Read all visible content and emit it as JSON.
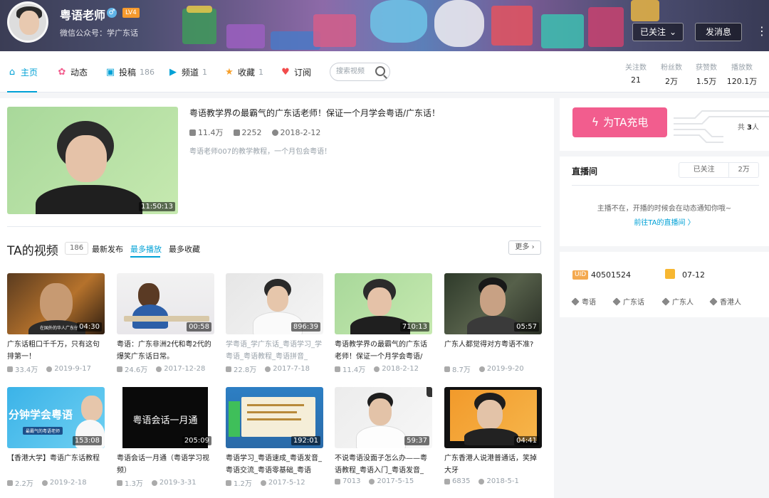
{
  "header": {
    "username": "粤语老师",
    "gender_icon": "male-icon",
    "level": "LV4",
    "subtitle": "微信公众号：学广东话",
    "follow_label": "已关注",
    "message_label": "发消息"
  },
  "nav": {
    "tabs": [
      {
        "label": "主页",
        "count": "",
        "icon": "home-icon"
      },
      {
        "label": "动态",
        "count": "",
        "icon": "feed-icon"
      },
      {
        "label": "投稿",
        "count": "186",
        "icon": "upload-icon"
      },
      {
        "label": "频道",
        "count": "1",
        "icon": "channel-icon"
      },
      {
        "label": "收藏",
        "count": "1",
        "icon": "star-icon"
      },
      {
        "label": "订阅",
        "count": "",
        "icon": "heart-icon"
      }
    ],
    "search_placeholder": "搜索视频",
    "stats": [
      {
        "label": "关注数",
        "value": "21"
      },
      {
        "label": "粉丝数",
        "value": "2万"
      },
      {
        "label": "获赞数",
        "value": "1.5万"
      },
      {
        "label": "播放数",
        "value": "120.1万"
      }
    ]
  },
  "featured": {
    "title": "粤语教学界の最霸气的广东话老师！保证一个月学会粤语/广东话！",
    "views": "11.4万",
    "danmaku": "2252",
    "date": "2018-2-12",
    "description": "粤语老师007的教学教程，一个月包会粤语！",
    "duration": "11:50:13"
  },
  "videos_section": {
    "title": "TA的视频",
    "count": "186",
    "sorts": [
      "最新发布",
      "最多播放",
      "最多收藏"
    ],
    "more": "更多"
  },
  "videos": [
    {
      "title": "广东话粗口千千万，只有这句排第一！",
      "views": "33.4万",
      "date": "2019-9-17",
      "duration": "04:30",
      "thumb_caption": "在国外的华人广东仔"
    },
    {
      "title": "粤语：广东非洲2代和粤2代的爆笑广东话日常。",
      "views": "24.6万",
      "date": "2017-12-28",
      "duration": "00:58",
      "thumb_caption": ""
    },
    {
      "title": "学粤语_学广东话_粤语学习_学粤语_粤语教程_粤语拼音_",
      "views": "22.8万",
      "date": "2017-7-18",
      "duration": "896:39",
      "thumb_caption": ""
    },
    {
      "title": "粤语教学界の最霸气的广东话老师！保证一个月学会粤语/",
      "views": "11.4万",
      "date": "2018-2-12",
      "duration": "710:13",
      "thumb_caption": ""
    },
    {
      "title": "广东人都觉得对方粤语不准?",
      "views": "8.7万",
      "date": "2019-9-20",
      "duration": "05:57",
      "thumb_caption": ""
    },
    {
      "title": "【香港大学】粤语广东话教程",
      "views": "2.2万",
      "date": "2019-2-18",
      "duration": "153:08",
      "thumb_caption": "分钟学会粤语",
      "thumb_sub": "最霸气的粤语老师"
    },
    {
      "title": "粤语会话一月通（粤语学习视频）",
      "views": "1.3万",
      "date": "2019-3-31",
      "duration": "205:09",
      "thumb_caption": "粤语会话一月通"
    },
    {
      "title": "粤语学习_粤语速成_粤语发音_粤语交流_粤语零基础_粤语",
      "views": "1.2万",
      "date": "2017-5-12",
      "duration": "192:01",
      "thumb_caption": ""
    },
    {
      "title": "不说粤语没面子怎么办——粤语教程_粤语入门_粤语发音_",
      "views": "7013",
      "date": "2017-5-15",
      "duration": "59:37",
      "thumb_caption": ""
    },
    {
      "title": "广东香港人说港普通话，笑掉大牙",
      "views": "6835",
      "date": "2018-5-1",
      "duration": "04:41",
      "thumb_caption": ""
    }
  ],
  "sidebar": {
    "charge_label": "为TA充电",
    "charge_total_prefix": "共",
    "charge_total_count": "3",
    "charge_total_suffix": "人",
    "live_title": "直播间",
    "live_tab_followed": "已关注",
    "live_tab_count": "2万",
    "live_message": "主播不在，开播的时候会在动态通知你哦~",
    "live_link": "前往TA的直播间 〉",
    "uid_badge": "UID",
    "uid": "40501524",
    "birthday": "07-12",
    "tags": [
      "粤语",
      "广东话",
      "广东人",
      "香港人"
    ]
  },
  "colors": {
    "accent": "#00a1d6",
    "charge": "#f25d8e",
    "level": "#f69a2d"
  }
}
